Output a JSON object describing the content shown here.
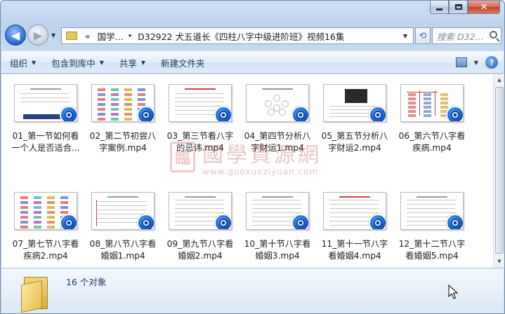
{
  "window": {
    "minimize": "",
    "maximize": "",
    "close": "✕"
  },
  "nav": {
    "back": "◀",
    "forward": "▶",
    "crumbs": [
      "«",
      "国学...",
      "▸",
      "D32922  犬五道长《四柱八字中级进阶班》视频16集"
    ],
    "search_placeholder": "搜索 D32..."
  },
  "commands": {
    "organize": "组织",
    "include_in_library": "包含到库中",
    "share": "共享",
    "new_folder": "新建文件夹",
    "help": "?"
  },
  "files": [
    {
      "name": "01_第一节如何看一个人是否适合...",
      "thumb": "doc-title"
    },
    {
      "name": "02_第二节初尝八字案例.mp4",
      "thumb": "table-color"
    },
    {
      "name": "03_第三节看八字的忌讳.mp4",
      "thumb": "doc-heading"
    },
    {
      "name": "04_第四节分析八字财运1.mp4",
      "thumb": "circles"
    },
    {
      "name": "05_第五节分析八字财运2.mp4",
      "thumb": "black-panel"
    },
    {
      "name": "06_第六节八字看疾病.mp4",
      "thumb": "red-grid"
    },
    {
      "name": "07_第七节八字看疾病2.mp4",
      "thumb": "table-color2"
    },
    {
      "name": "08_第八节八字看婚姻1.mp4",
      "thumb": "doc-red"
    },
    {
      "name": "09_第九节八字看婚姻2.mp4",
      "thumb": "doc-text"
    },
    {
      "name": "10_第十节八字看婚姻3.mp4",
      "thumb": "doc-text"
    },
    {
      "name": "11_第十一节八字看婚姻4.mp4",
      "thumb": "doc-red2"
    },
    {
      "name": "12_第十二节八字看婚姻5.mp4",
      "thumb": "doc-text"
    }
  ],
  "details": {
    "count": "16 个对象"
  },
  "watermark": {
    "seal": "臨",
    "name": "國學資源網",
    "url": "www.guoxueziyuan.com"
  }
}
